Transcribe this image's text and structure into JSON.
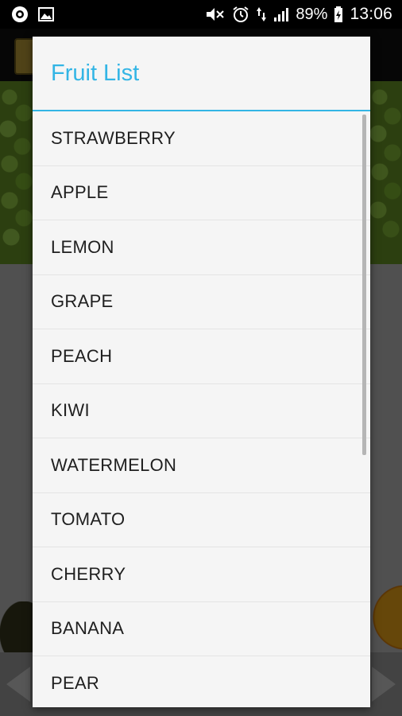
{
  "status_bar": {
    "left_icons": [
      "notification-circle-icon",
      "image-icon"
    ],
    "right_icons": [
      "mute-icon",
      "alarm-icon",
      "data-transfer-icon",
      "signal-icon",
      "battery-icon"
    ],
    "battery_percent": "89%",
    "time": "13:06"
  },
  "dialog": {
    "title": "Fruit List",
    "accent_color": "#33b5e5",
    "items": [
      {
        "label": "STRAWBERRY"
      },
      {
        "label": "APPLE"
      },
      {
        "label": "LEMON"
      },
      {
        "label": "GRAPE"
      },
      {
        "label": "PEACH"
      },
      {
        "label": "KIWI"
      },
      {
        "label": "WATERMELON"
      },
      {
        "label": "TOMATO"
      },
      {
        "label": "CHERRY"
      },
      {
        "label": "BANANA"
      },
      {
        "label": "PEAR"
      }
    ]
  }
}
